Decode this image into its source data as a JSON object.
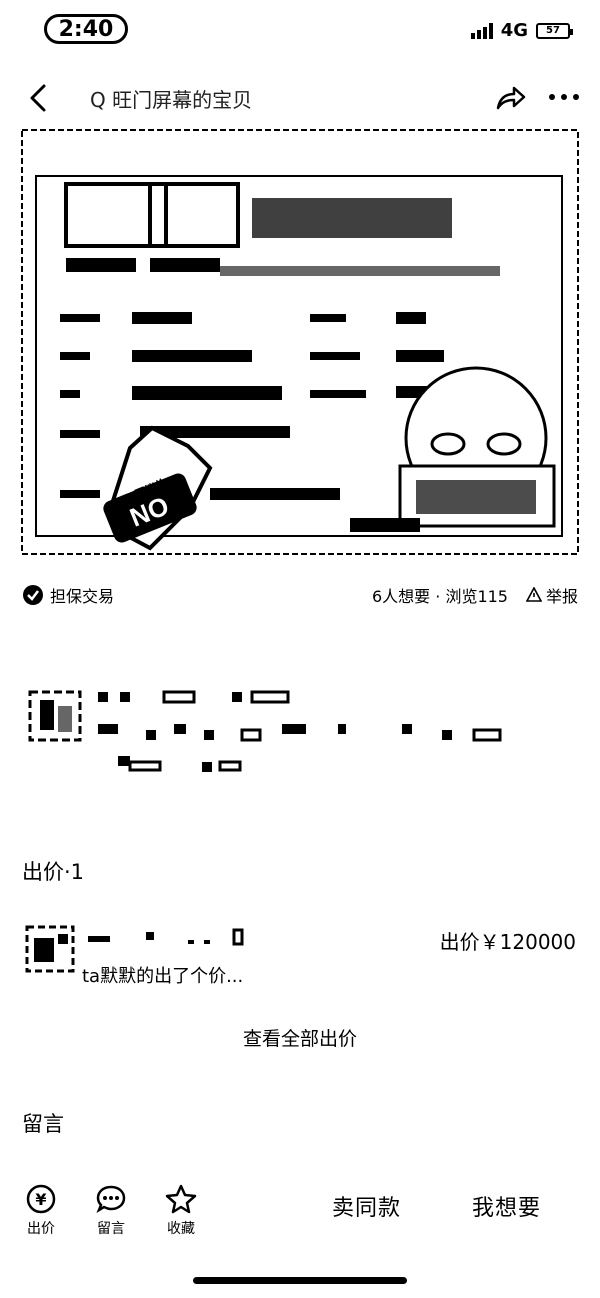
{
  "status_bar": {
    "time": "2:40",
    "network": "4G",
    "battery": "57"
  },
  "nav": {
    "search_placeholder": "Q 旺门屏幕的宝贝"
  },
  "info": {
    "guarantee": "担保交易",
    "stats": "6人想要 · 浏览115",
    "report": "举报"
  },
  "bids": {
    "title": "出价·1",
    "items": [
      {
        "price": "出价￥120000",
        "message": "ta默默的出了个价..."
      }
    ],
    "view_all": "查看全部出价"
  },
  "messages": {
    "title": "留言"
  },
  "bottom_bar": {
    "items": [
      {
        "label": "出价",
        "icon": "yen-icon"
      },
      {
        "label": "留言",
        "icon": "chat-icon"
      },
      {
        "label": "收藏",
        "icon": "star-icon"
      }
    ],
    "sell_same": "卖同款",
    "want": "我想要"
  },
  "sticker": {
    "badge_text": "NO",
    "badge_subtext": "不议价"
  }
}
